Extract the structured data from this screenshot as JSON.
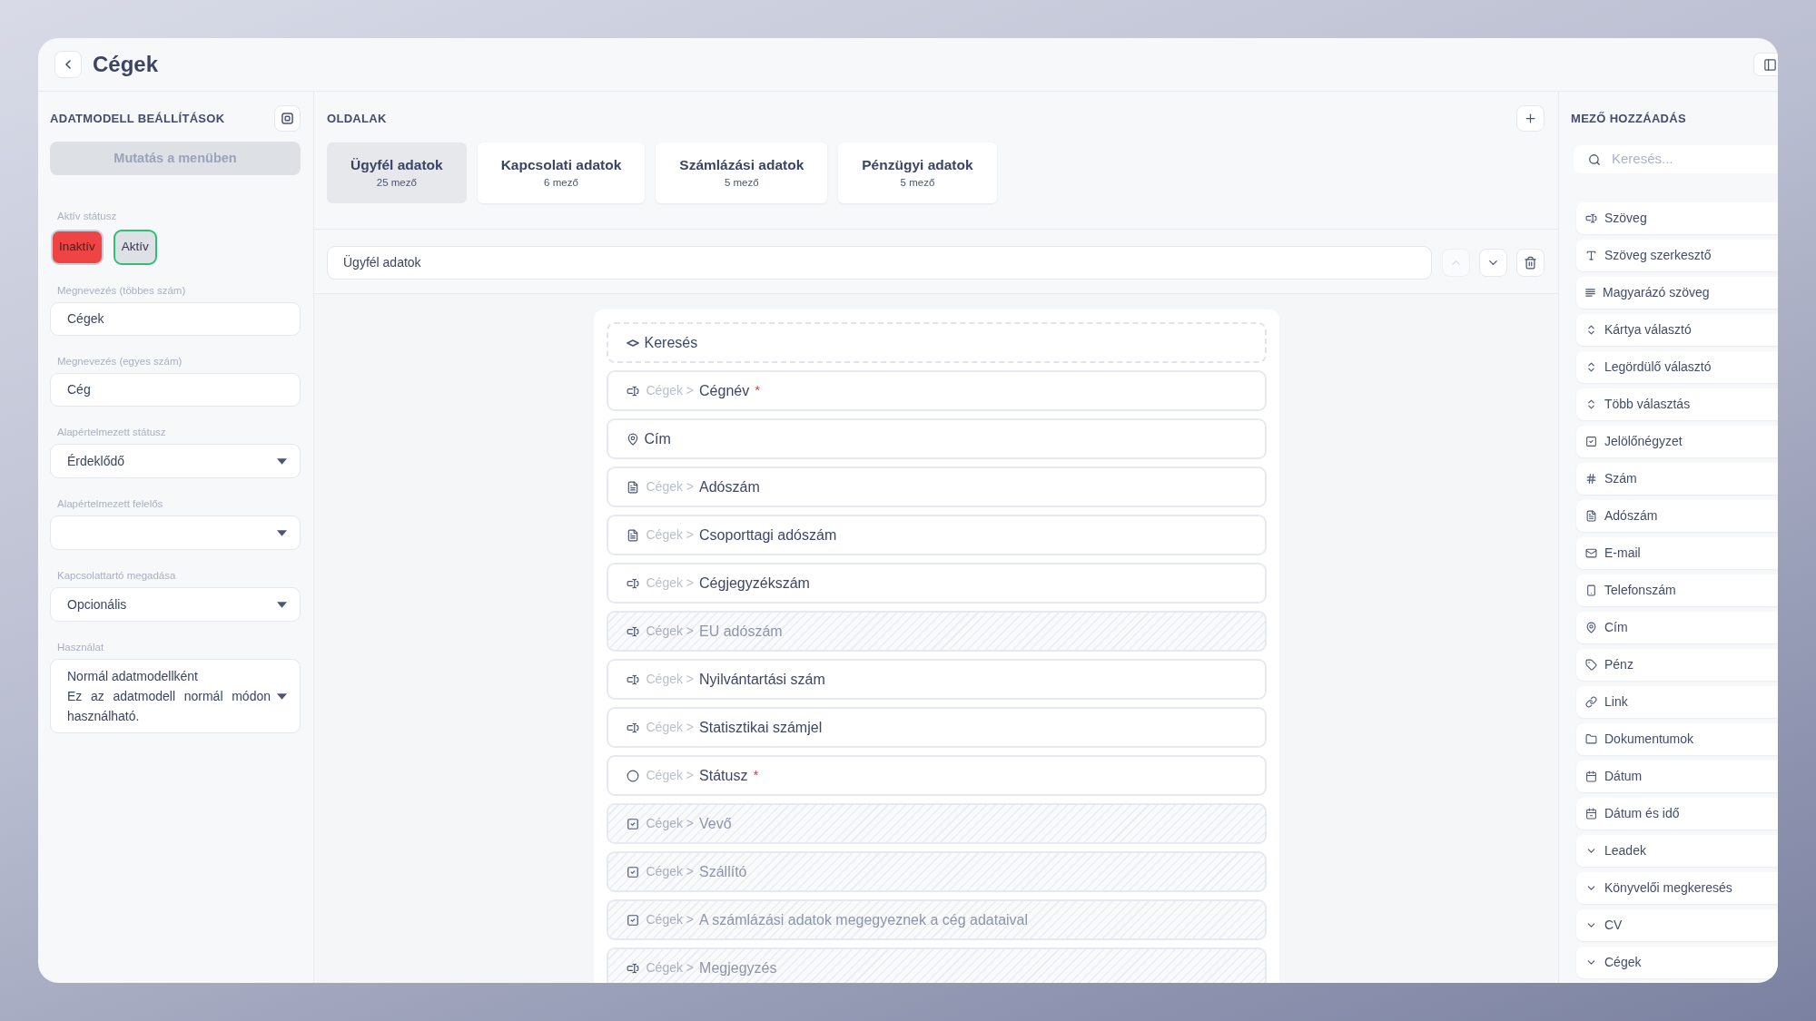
{
  "window": {
    "title": "Cégek"
  },
  "sidebar": {
    "title": "ADATMODELL BEÁLLÍTÁSOK",
    "menu_button": "Mutatás a menüben",
    "status": {
      "label": "Aktív státusz",
      "options": [
        {
          "label": "Inaktív",
          "selected": true,
          "color": "#ef4444"
        },
        {
          "label": "Aktív",
          "selected": false,
          "color": "#2fbf71"
        }
      ]
    },
    "fields": [
      {
        "kind": "text",
        "label": "Megnevezés (többes szám)",
        "value": "Cégek"
      },
      {
        "kind": "text",
        "label": "Megnevezés (egyes szám)",
        "value": "Cég"
      },
      {
        "kind": "select",
        "label": "Alapértelmezett státusz",
        "value": "Érdeklődő"
      },
      {
        "kind": "select",
        "label": "Alapértelmezett felelős"
      },
      {
        "kind": "select",
        "label": "Kapcsolattartó megadása",
        "value": "Opcionális"
      },
      {
        "kind": "select",
        "label": "Használat",
        "value": "Normál adatmodellként",
        "description": "Ez az adatmodell normál módon használható."
      }
    ]
  },
  "pages": {
    "title": "OLDALAK",
    "tabs": [
      {
        "label": "Ügyfél adatok",
        "count": "25 mező",
        "selected": true
      },
      {
        "label": "Kapcsolati adatok",
        "count": "6 mező",
        "selected": false
      },
      {
        "label": "Számlázási adatok",
        "count": "5 mező",
        "selected": false
      },
      {
        "label": "Pénzügyi adatok",
        "count": "5 mező",
        "selected": false
      }
    ],
    "editor": {
      "name": "Ügyfél adatok",
      "controls": [
        {
          "kind": "up",
          "disabled": true
        },
        {
          "kind": "down",
          "disabled": false
        },
        {
          "kind": "delete",
          "disabled": false
        }
      ]
    }
  },
  "field_list": {
    "required_mark": "*",
    "rows": [
      {
        "kind": "search",
        "label": "Keresés",
        "required": false,
        "disabled": false
      },
      {
        "kind": "text",
        "path": "Cégek >",
        "label": "Cégnév",
        "required": true,
        "disabled": false
      },
      {
        "kind": "address",
        "label": "Cím",
        "required": false,
        "disabled": false
      },
      {
        "kind": "tax_number",
        "path": "Cégek >",
        "label": "Adószám",
        "required": false,
        "disabled": false
      },
      {
        "kind": "tax_number",
        "path": "Cégek >",
        "label": "Csoporttagi adószám",
        "required": false,
        "disabled": false
      },
      {
        "kind": "text",
        "path": "Cégek >",
        "label": "Cégjegyzékszám",
        "required": false,
        "disabled": false
      },
      {
        "kind": "text",
        "path": "Cégek >",
        "label": "EU adószám",
        "required": false,
        "disabled": true
      },
      {
        "kind": "text",
        "path": "Cégek >",
        "label": "Nyilvántartási szám",
        "required": false,
        "disabled": false
      },
      {
        "kind": "text",
        "path": "Cégek >",
        "label": "Statisztikai számjel",
        "required": false,
        "disabled": false
      },
      {
        "kind": "status",
        "path": "Cégek >",
        "label": "Státusz",
        "required": true,
        "disabled": false
      },
      {
        "kind": "checkbox",
        "path": "Cégek >",
        "label": "Vevő",
        "required": false,
        "disabled": true
      },
      {
        "kind": "checkbox",
        "path": "Cégek >",
        "label": "Szállító",
        "required": false,
        "disabled": true
      },
      {
        "kind": "checkbox",
        "path": "Cégek >",
        "label": "A számlázási adatok megegyeznek a cég adataival",
        "required": false,
        "disabled": true
      },
      {
        "kind": "text",
        "path": "Cégek >",
        "label": "Megjegyzés",
        "required": false,
        "disabled": true
      }
    ]
  },
  "field_palette": {
    "title": "MEZŐ HOZZÁADÁS",
    "search": {
      "placeholder": "Keresés..."
    },
    "items": [
      {
        "kind": "text",
        "label": "Szöveg"
      },
      {
        "kind": "rich_text",
        "label": "Szöveg szerkesztő"
      },
      {
        "kind": "description",
        "label": "Magyarázó szöveg"
      },
      {
        "kind": "choice",
        "label": "Kártya választó"
      },
      {
        "kind": "choice",
        "label": "Legördülő választó"
      },
      {
        "kind": "choice",
        "label": "Több választás"
      },
      {
        "kind": "checkbox",
        "label": "Jelölőnégyzet"
      },
      {
        "kind": "number",
        "label": "Szám"
      },
      {
        "kind": "tax_number",
        "label": "Adószám"
      },
      {
        "kind": "email",
        "label": "E-mail"
      },
      {
        "kind": "phone",
        "label": "Telefonszám"
      },
      {
        "kind": "address",
        "label": "Cím"
      },
      {
        "kind": "money",
        "label": "Pénz"
      },
      {
        "kind": "link",
        "label": "Link"
      },
      {
        "kind": "documents",
        "label": "Dokumentumok"
      },
      {
        "kind": "date",
        "label": "Dátum"
      },
      {
        "kind": "datetime",
        "label": "Dátum és idő"
      },
      {
        "kind": "relation",
        "label": "Leadek"
      },
      {
        "kind": "relation",
        "label": "Könyvelői megkeresés"
      },
      {
        "kind": "relation",
        "label": "CV"
      },
      {
        "kind": "relation",
        "label": "Cégek"
      }
    ]
  }
}
